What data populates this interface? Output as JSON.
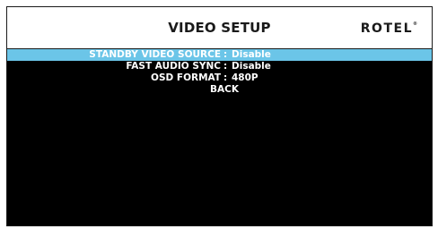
{
  "title": "VIDEO SETUP",
  "brand": {
    "name": "ROTEL",
    "trademark": "®"
  },
  "menu": {
    "items": [
      {
        "label": "STANDBY VIDEO SOURCE",
        "separator": ":",
        "value": "Disable",
        "selected": true
      },
      {
        "label": "FAST AUDIO SYNC",
        "separator": ":",
        "value": "Disable",
        "selected": false
      },
      {
        "label": "OSD FORMAT",
        "separator": ":",
        "value": "480P",
        "selected": false
      }
    ],
    "back_label": "BACK"
  },
  "colors": {
    "selection": "#6bc5e8",
    "background": "#000000",
    "header": "#ffffff",
    "text": "#ffffff"
  }
}
